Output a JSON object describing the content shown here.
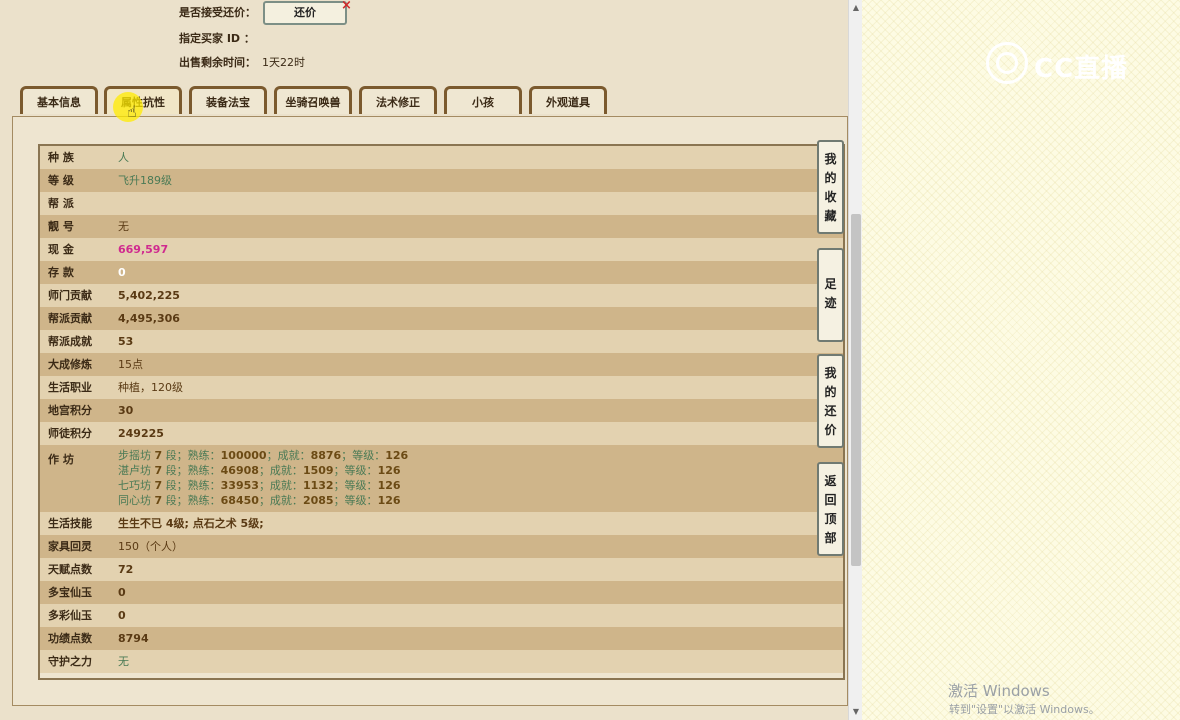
{
  "header": {
    "accept_counter_label": "是否接受还价：",
    "counter_button": "还价",
    "close_mark": "×",
    "buyer_id_label": "指定买家 ID ：",
    "time_left_label": "出售剩余时间：",
    "time_left_value": "1天22时"
  },
  "tabs": [
    {
      "label": "基本信息"
    },
    {
      "label": "属性抗性"
    },
    {
      "label": "装备法宝"
    },
    {
      "label": "坐骑召唤兽"
    },
    {
      "label": "法术修正"
    },
    {
      "label": "小孩"
    },
    {
      "label": "外观道具"
    }
  ],
  "rows": [
    {
      "label": "种    族",
      "value": "人"
    },
    {
      "label": "等    级",
      "value": "飞升189级"
    },
    {
      "label": "帮    派",
      "value": ""
    },
    {
      "label": "靓    号",
      "value": "无"
    },
    {
      "label": "现    金",
      "value": "669,597"
    },
    {
      "label": "存    款",
      "value": "0"
    },
    {
      "label": "师门贡献",
      "value": "5,402,225"
    },
    {
      "label": "帮派贡献",
      "value": "4,495,306"
    },
    {
      "label": "帮派成就",
      "value": "53"
    },
    {
      "label": "大成修炼",
      "value": "15点"
    },
    {
      "label": "生活职业",
      "value": "种植，120级"
    },
    {
      "label": "地宫积分",
      "value": "30"
    },
    {
      "label": "师徒积分",
      "value": "249225"
    }
  ],
  "workshop": {
    "label": "作    坊",
    "lines": [
      {
        "name": "步摇坊",
        "seg": "7",
        "seg_unit": " 段；熟练：",
        "skill": "100000",
        "ach_label": "；成就：",
        "ach": "8876",
        "lvl_label": "；等级：",
        "lvl": "126"
      },
      {
        "name": "湛卢坊",
        "seg": "7",
        "seg_unit": " 段；熟练：",
        "skill": "46908",
        "ach_label": "；成就：",
        "ach": "1509",
        "lvl_label": "；等级：",
        "lvl": "126"
      },
      {
        "name": "七巧坊",
        "seg": "7",
        "seg_unit": " 段；熟练：",
        "skill": "33953",
        "ach_label": "；成就：",
        "ach": "1132",
        "lvl_label": "；等级：",
        "lvl": "126"
      },
      {
        "name": "同心坊",
        "seg": "7",
        "seg_unit": " 段；熟练：",
        "skill": "68450",
        "ach_label": "；成就：",
        "ach": "2085",
        "lvl_label": "；等级：",
        "lvl": "126"
      }
    ]
  },
  "rows2": [
    {
      "label": "生活技能",
      "value": "生生不已 4级; 点石之术 5级;"
    },
    {
      "label": "家具回灵",
      "value": "150（个人）"
    },
    {
      "label": "天赋点数",
      "value": "72"
    },
    {
      "label": "多宝仙玉",
      "value": "0"
    },
    {
      "label": "多彩仙玉",
      "value": "0"
    },
    {
      "label": "功绩点数",
      "value": "8794"
    },
    {
      "label": "守护之力",
      "value": "无"
    }
  ],
  "side_buttons": [
    {
      "chars": [
        "我",
        "的",
        "收",
        "藏"
      ]
    },
    {
      "chars": [
        "足",
        "迹"
      ]
    },
    {
      "chars": [
        "我",
        "的",
        "还",
        "价"
      ]
    },
    {
      "chars": [
        "返",
        "回",
        "顶",
        "部"
      ]
    }
  ],
  "scrollbar": {
    "up": "▲",
    "down": "▼"
  },
  "logo": {
    "text": "CC直播"
  },
  "cursor": {
    "glyph": "☝"
  },
  "watermark": {
    "line1": "激活 Windows",
    "line2": "转到\"设置\"以激活 Windows。"
  },
  "colors": {
    "green": "#4a7a55",
    "magenta": "#d02b8f",
    "tab_border": "#7b5a2e",
    "row_light": "#e3d2b0",
    "row_dark": "#cfb58a"
  }
}
